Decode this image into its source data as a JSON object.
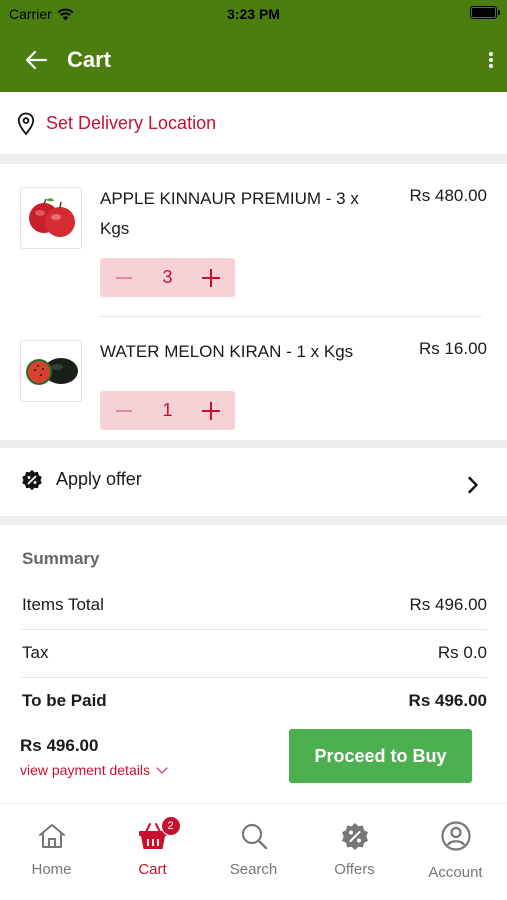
{
  "status_bar": {
    "carrier": "Carrier",
    "time": "3:23 PM"
  },
  "header": {
    "title": "Cart",
    "back_icon": "arrow-left-icon",
    "menu_icon": "more-vertical-icon",
    "color": "#4b7e0f"
  },
  "delivery": {
    "label": "Set Delivery Location",
    "icon": "location-pin-icon",
    "color": "#c8102e"
  },
  "cart_items": [
    {
      "name": "APPLE KINNAUR PREMIUM - 3 x Kgs",
      "price": "Rs 480.00",
      "quantity": "3",
      "image": "apple-image"
    },
    {
      "name": "WATER MELON KIRAN - 1 x Kgs",
      "price": "Rs 16.00",
      "quantity": "1",
      "image": "watermelon-image"
    }
  ],
  "offer": {
    "label": "Apply offer",
    "icon": "discount-badge-icon"
  },
  "summary": {
    "heading": "Summary",
    "rows": [
      {
        "label": "Items Total",
        "value": "Rs 496.00"
      },
      {
        "label": "Tax",
        "value": "Rs 0.0"
      },
      {
        "label": "To be Paid",
        "value": "Rs 496.00"
      }
    ]
  },
  "checkout": {
    "total": "Rs 496.00",
    "details_link": "view payment details",
    "button_label": "Proceed to Buy",
    "button_color": "#4caf50"
  },
  "tabs": [
    {
      "label": "Home",
      "icon": "home-icon"
    },
    {
      "label": "Cart",
      "icon": "basket-icon",
      "badge": "2",
      "active": true
    },
    {
      "label": "Search",
      "icon": "search-icon"
    },
    {
      "label": "Offers",
      "icon": "discount-badge-icon"
    },
    {
      "label": "Account",
      "icon": "account-icon"
    }
  ]
}
